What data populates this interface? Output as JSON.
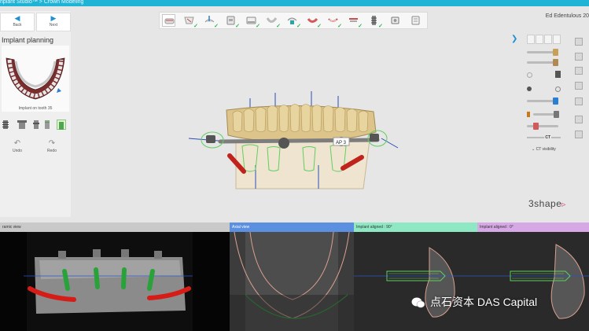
{
  "app": {
    "title": "nplant Studio™ > Crown Modeling",
    "case_name": "Ed Edentulous 20",
    "accent_color": "#1fb3d6"
  },
  "left_panel": {
    "back_label": "Back",
    "next_label": "Next",
    "title": "Implant planning",
    "caption": "Implant on tooth 35",
    "undo_label": "Undo",
    "redo_label": "Redo"
  },
  "toolbar": {
    "tools": [
      "scan-tool",
      "prep-tool",
      "insertion-tool",
      "model-tool",
      "gingiva-tool",
      "crown-tool",
      "arch-tool",
      "gum-tool",
      "teeth-tool",
      "bar-tool",
      "implant-tool",
      "abutment-tool",
      "screw-tool"
    ]
  },
  "right_panel": {
    "tabs": [
      "1",
      "2",
      "3",
      "4"
    ],
    "ct_label": "CT",
    "ct_visibility_label": "CT visibility"
  },
  "scene": {
    "annotation": "AP 3"
  },
  "logo": "3shape",
  "views": {
    "panoramic": "ramic view",
    "axial": "Axial view",
    "aligned_90": "Implant aligned : 90°",
    "aligned_0": "Implant aligned : 0°",
    "colors": {
      "panoramic": "#c9c9c9",
      "axial": "#5b8fe0",
      "aligned_90": "#8fe8c4",
      "aligned_0": "#d6a9e6"
    }
  },
  "watermark": "点石资本 DAS Capital"
}
